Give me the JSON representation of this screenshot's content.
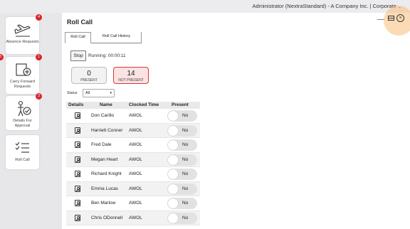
{
  "topbar": {
    "account": "Administrator (NextraStandard) - A Company Inc. | Corporate",
    "caret": "⌄"
  },
  "sidebar": {
    "cards": [
      {
        "label": "Absence Requests",
        "badge": "4"
      },
      {
        "label": "Carry Forward Requests",
        "badge": "1",
        "left_badge": "8"
      },
      {
        "label": "Details For Approval",
        "badge": "3"
      },
      {
        "label": "Roll Call",
        "badge": ""
      }
    ]
  },
  "panel": {
    "title": "Roll Call",
    "minimize": "—",
    "close": "×",
    "tabs": [
      "Roll Call",
      "Roll Call History"
    ],
    "stop_label": "Stop",
    "running": "Running: 00:00:11",
    "present": {
      "count": "0",
      "label": "PRESENT"
    },
    "not_present": {
      "count": "14",
      "label": "NOT PRESENT"
    },
    "status_label": "Status:",
    "status_value": "All"
  },
  "table": {
    "headers": [
      "Details",
      "Name",
      "Clocked Time",
      "Present"
    ],
    "rows": [
      {
        "name": "Don Carillo",
        "time": "AWOL",
        "present": "No"
      },
      {
        "name": "Harriett Conner",
        "time": "AWOL",
        "present": "No"
      },
      {
        "name": "Fred Dale",
        "time": "AWOL",
        "present": "No"
      },
      {
        "name": "Megan Heart",
        "time": "AWOL",
        "present": "No"
      },
      {
        "name": "Richard Knight",
        "time": "AWOL",
        "present": "No"
      },
      {
        "name": "Emma Lucas",
        "time": "AWOL",
        "present": "No"
      },
      {
        "name": "Ben Marlow",
        "time": "AWOL",
        "present": "No"
      },
      {
        "name": "Chris ODonnell",
        "time": "AWOL",
        "present": "No"
      }
    ]
  },
  "colors": {
    "badge": "#d8262c",
    "not_present_border": "#d23a3a",
    "highlight": "#f7be78"
  }
}
